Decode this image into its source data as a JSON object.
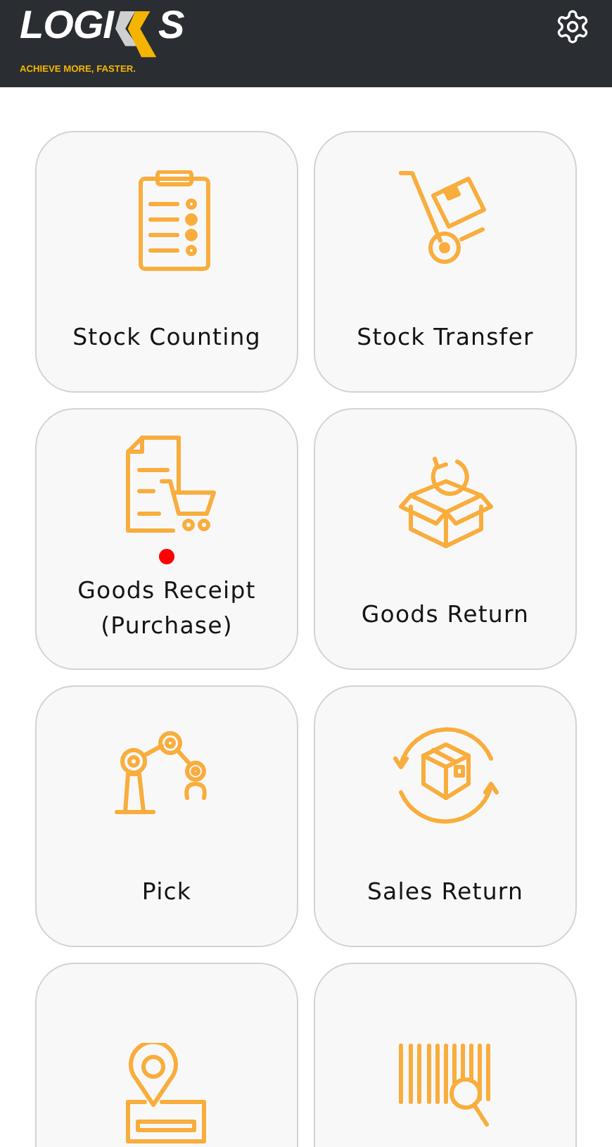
{
  "header": {
    "logo": {
      "left": "LOGI",
      "right": "S",
      "tagline": "ACHIEVE MORE, FASTER."
    }
  },
  "tiles": [
    {
      "kind": "clipboard",
      "label": "Stock Counting",
      "alert": false
    },
    {
      "kind": "trolley",
      "label": "Stock Transfer",
      "alert": false
    },
    {
      "kind": "receipt",
      "label": "Goods Receipt (Purchase)",
      "alert": true
    },
    {
      "kind": "box-return",
      "label": "Goods Return",
      "alert": false
    },
    {
      "kind": "robot-arm",
      "label": "Pick",
      "alert": false
    },
    {
      "kind": "box-cycle",
      "label": "Sales Return",
      "alert": false
    },
    {
      "kind": "location",
      "alert": false
    },
    {
      "kind": "barcode",
      "alert": false
    }
  ]
}
